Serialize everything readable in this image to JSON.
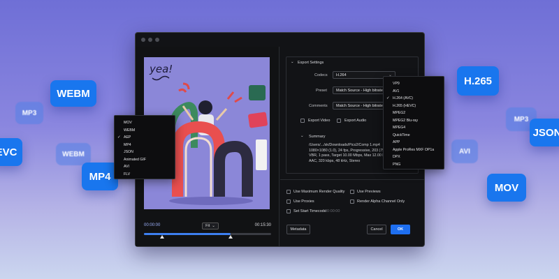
{
  "floating_tiles": [
    {
      "label": "WEBM",
      "style": "solid"
    },
    {
      "label": "MP3",
      "style": "faded"
    },
    {
      "label": "EVC",
      "style": "solid"
    },
    {
      "label": "WEBM",
      "style": "faded"
    },
    {
      "label": "MP4",
      "style": "solid"
    },
    {
      "label": "H.265",
      "style": "solid"
    },
    {
      "label": "MP3",
      "style": "faded"
    },
    {
      "label": "JSON",
      "style": "solid"
    },
    {
      "label": "AVI",
      "style": "faded"
    },
    {
      "label": "MOV",
      "style": "solid"
    }
  ],
  "preview": {
    "artwork_text": "yea!",
    "time_start": "00:00:00",
    "time_end": "00:15:30",
    "fit_label": "Fit",
    "progress": 0.68
  },
  "export_settings": {
    "section_title": "Export Settings",
    "codecs_label": "Codecs",
    "codecs_value": "H.264",
    "preset_label": "Preset",
    "preset_value": "Match Source - High bitrate",
    "comments_label": "Comments",
    "comments_value": "Match Source - High bitrate",
    "export_video_label": "Export Video",
    "export_audio_label": "Export Audio"
  },
  "summary": {
    "title": "Summary",
    "lines": [
      "/Users/.../sk/Downloads/Pics2/Comp 1.mp4",
      "1080×1080 (1.0), 24 fps, Progressive, 203 (75% HL",
      "VBR, 1 pass, Target 10.00 Mbps, Max 12.00 Mbps",
      "AAC, 320 kbps, 48 kHz, Stereo"
    ]
  },
  "render_options": {
    "max_quality_label": "Use Maximum Render Quality",
    "use_previews_label": "Use Previews",
    "use_proxies_label": "Use Proxies",
    "render_alpha_label": "Render Alpha Channel Only",
    "set_start_timecode_label": "Set Start Timecode",
    "start_timecode_value": "00:00:00"
  },
  "buttons": {
    "metadata": "Metadata",
    "cancel": "Cancel",
    "ok": "OK"
  },
  "format_menu": {
    "items": [
      "MOV",
      "WEBM",
      "AEP",
      "MP4",
      "JSON",
      "Animated GIF",
      "AVI",
      "FLV"
    ],
    "selected": "AEP"
  },
  "codec_menu": {
    "items": [
      "VP9",
      "AV1",
      "H.264 (AVC)",
      "H.265 (HEVC)",
      "MPEG2",
      "MPEG2 Blu-ray",
      "MPEG4",
      "QuickTime",
      "APP",
      "Apple ProRes MXF OP1a",
      "DPX",
      "PNG"
    ],
    "selected": "H.264 (AVC)"
  },
  "colors": {
    "accent": "#1e6ff0",
    "tile": "#1976ee",
    "window_bg": "#121316",
    "background_top": "#6f6fd6"
  }
}
